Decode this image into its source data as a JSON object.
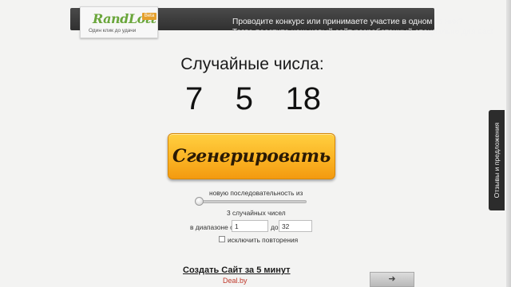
{
  "banner": {
    "logo_name": "RandLott",
    "logo_badge": "Beta",
    "logo_tagline": "Один клик до удачи",
    "line1": "Проводите конкурс или принимаете участие в одном из них?",
    "line2": "Тогда посетите наш новый сайт разработанный специально для вас!"
  },
  "main": {
    "heading": "Случайные числа:",
    "numbers": [
      "7",
      "5",
      "18"
    ],
    "generate_label": "Сгенерировать"
  },
  "controls": {
    "sequence_label": "новую последовательность из",
    "slider_level": 0,
    "count_label": "3 случайных чисел",
    "range_prefix": "в диапазоне от",
    "range_from": "1",
    "range_to_label": "до",
    "range_to": "32",
    "exclude_label": "исключить повторения",
    "exclude_checked": false
  },
  "ad": {
    "title": "Создать Сайт за 5 минут",
    "domain": "Deal.by",
    "next_icon": "arrow-right-icon"
  },
  "feedback": {
    "label": "Отзывы и предложения"
  },
  "colors": {
    "accent": "#fbb424",
    "banner_bg": "#3a3a3a",
    "logo_green": "#6aa63b",
    "ad_domain": "#c0392b"
  }
}
